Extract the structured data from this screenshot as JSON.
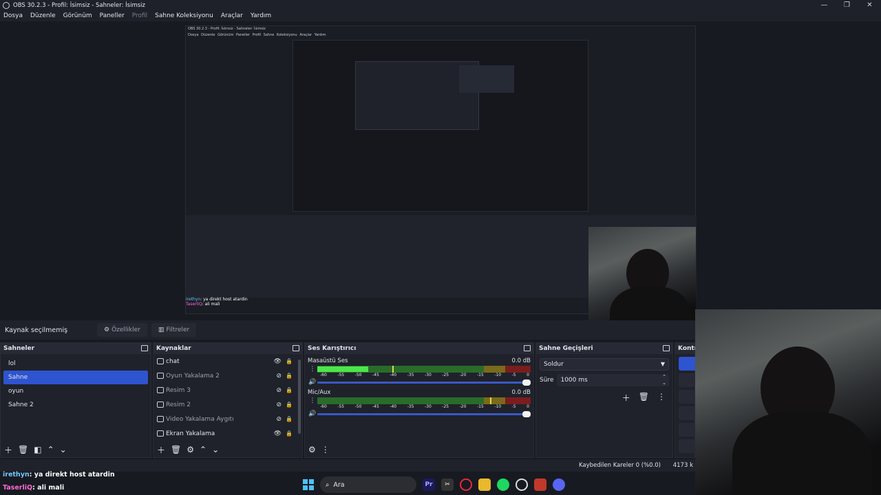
{
  "window": {
    "title": "OBS 30.2.3 - Profil: İsimsiz - Sahneler: İsimsiz",
    "controls": [
      "—",
      "❐",
      "✕"
    ]
  },
  "menu": [
    "Dosya",
    "Düzenle",
    "Görünüm",
    "Paneller",
    "Profil",
    "Sahne Koleksiyonu",
    "Araçlar",
    "Yardım"
  ],
  "nested": {
    "title": "OBS 30.2.3 - Profil: İsimsiz - Sahneler: İsimsiz",
    "menu": "Dosya Düzenle Görünüm Paneller Profil Sahne Koleksiyonu Araçlar Yardım",
    "chat1_user": "irethyn",
    "chat1_msg": ": ya direkt host atardin",
    "chat2_user": "TaserliQ",
    "chat2_msg": ": ali mali"
  },
  "toolbar": {
    "no_source": "Kaynak seçilmemiş",
    "properties": "Özellikler",
    "filters": "Filtreler"
  },
  "scenes": {
    "title": "Sahneler",
    "items": [
      "lol",
      "Sahne",
      "oyun",
      "Sahne 2"
    ],
    "active_index": 1
  },
  "sources": {
    "title": "Kaynaklar",
    "items": [
      {
        "label": "chat",
        "visible": true
      },
      {
        "label": "Oyun Yakalama 2",
        "visible": false
      },
      {
        "label": "Resim 3",
        "visible": false
      },
      {
        "label": "Resim 2",
        "visible": false
      },
      {
        "label": "Video Yakalama Aygıtı",
        "visible": false
      },
      {
        "label": "Ekran Yakalama",
        "visible": true
      }
    ]
  },
  "mixer": {
    "title": "Ses Karıştırıcı",
    "ticks": [
      "-60",
      "-55",
      "-50",
      "-45",
      "-40",
      "-35",
      "-30",
      "-25",
      "-20",
      "-15",
      "-10",
      "-5",
      "0"
    ],
    "channels": [
      {
        "name": "Masaüstü Ses",
        "db": "0.0 dB",
        "level": 0.24,
        "peak": 0.35
      },
      {
        "name": "Mic/Aux",
        "db": "0.0 dB",
        "level": 0.0,
        "peak": 0.81
      }
    ]
  },
  "transitions": {
    "title": "Sahne Geçişleri",
    "selected": "Soldur",
    "duration_label": "Süre",
    "duration_value": "1000 ms"
  },
  "controls": {
    "title": "Kontr"
  },
  "status": {
    "dropped": "Kaybedilen Kareler 0 (%0.0)",
    "kb": "4173 k"
  },
  "chat": [
    {
      "user": "irethyn",
      "msg": ": ya direkt host atardin"
    },
    {
      "user": "TaserliQ",
      "msg": ": ali mali"
    }
  ],
  "taskbar": {
    "search": "Ara"
  }
}
